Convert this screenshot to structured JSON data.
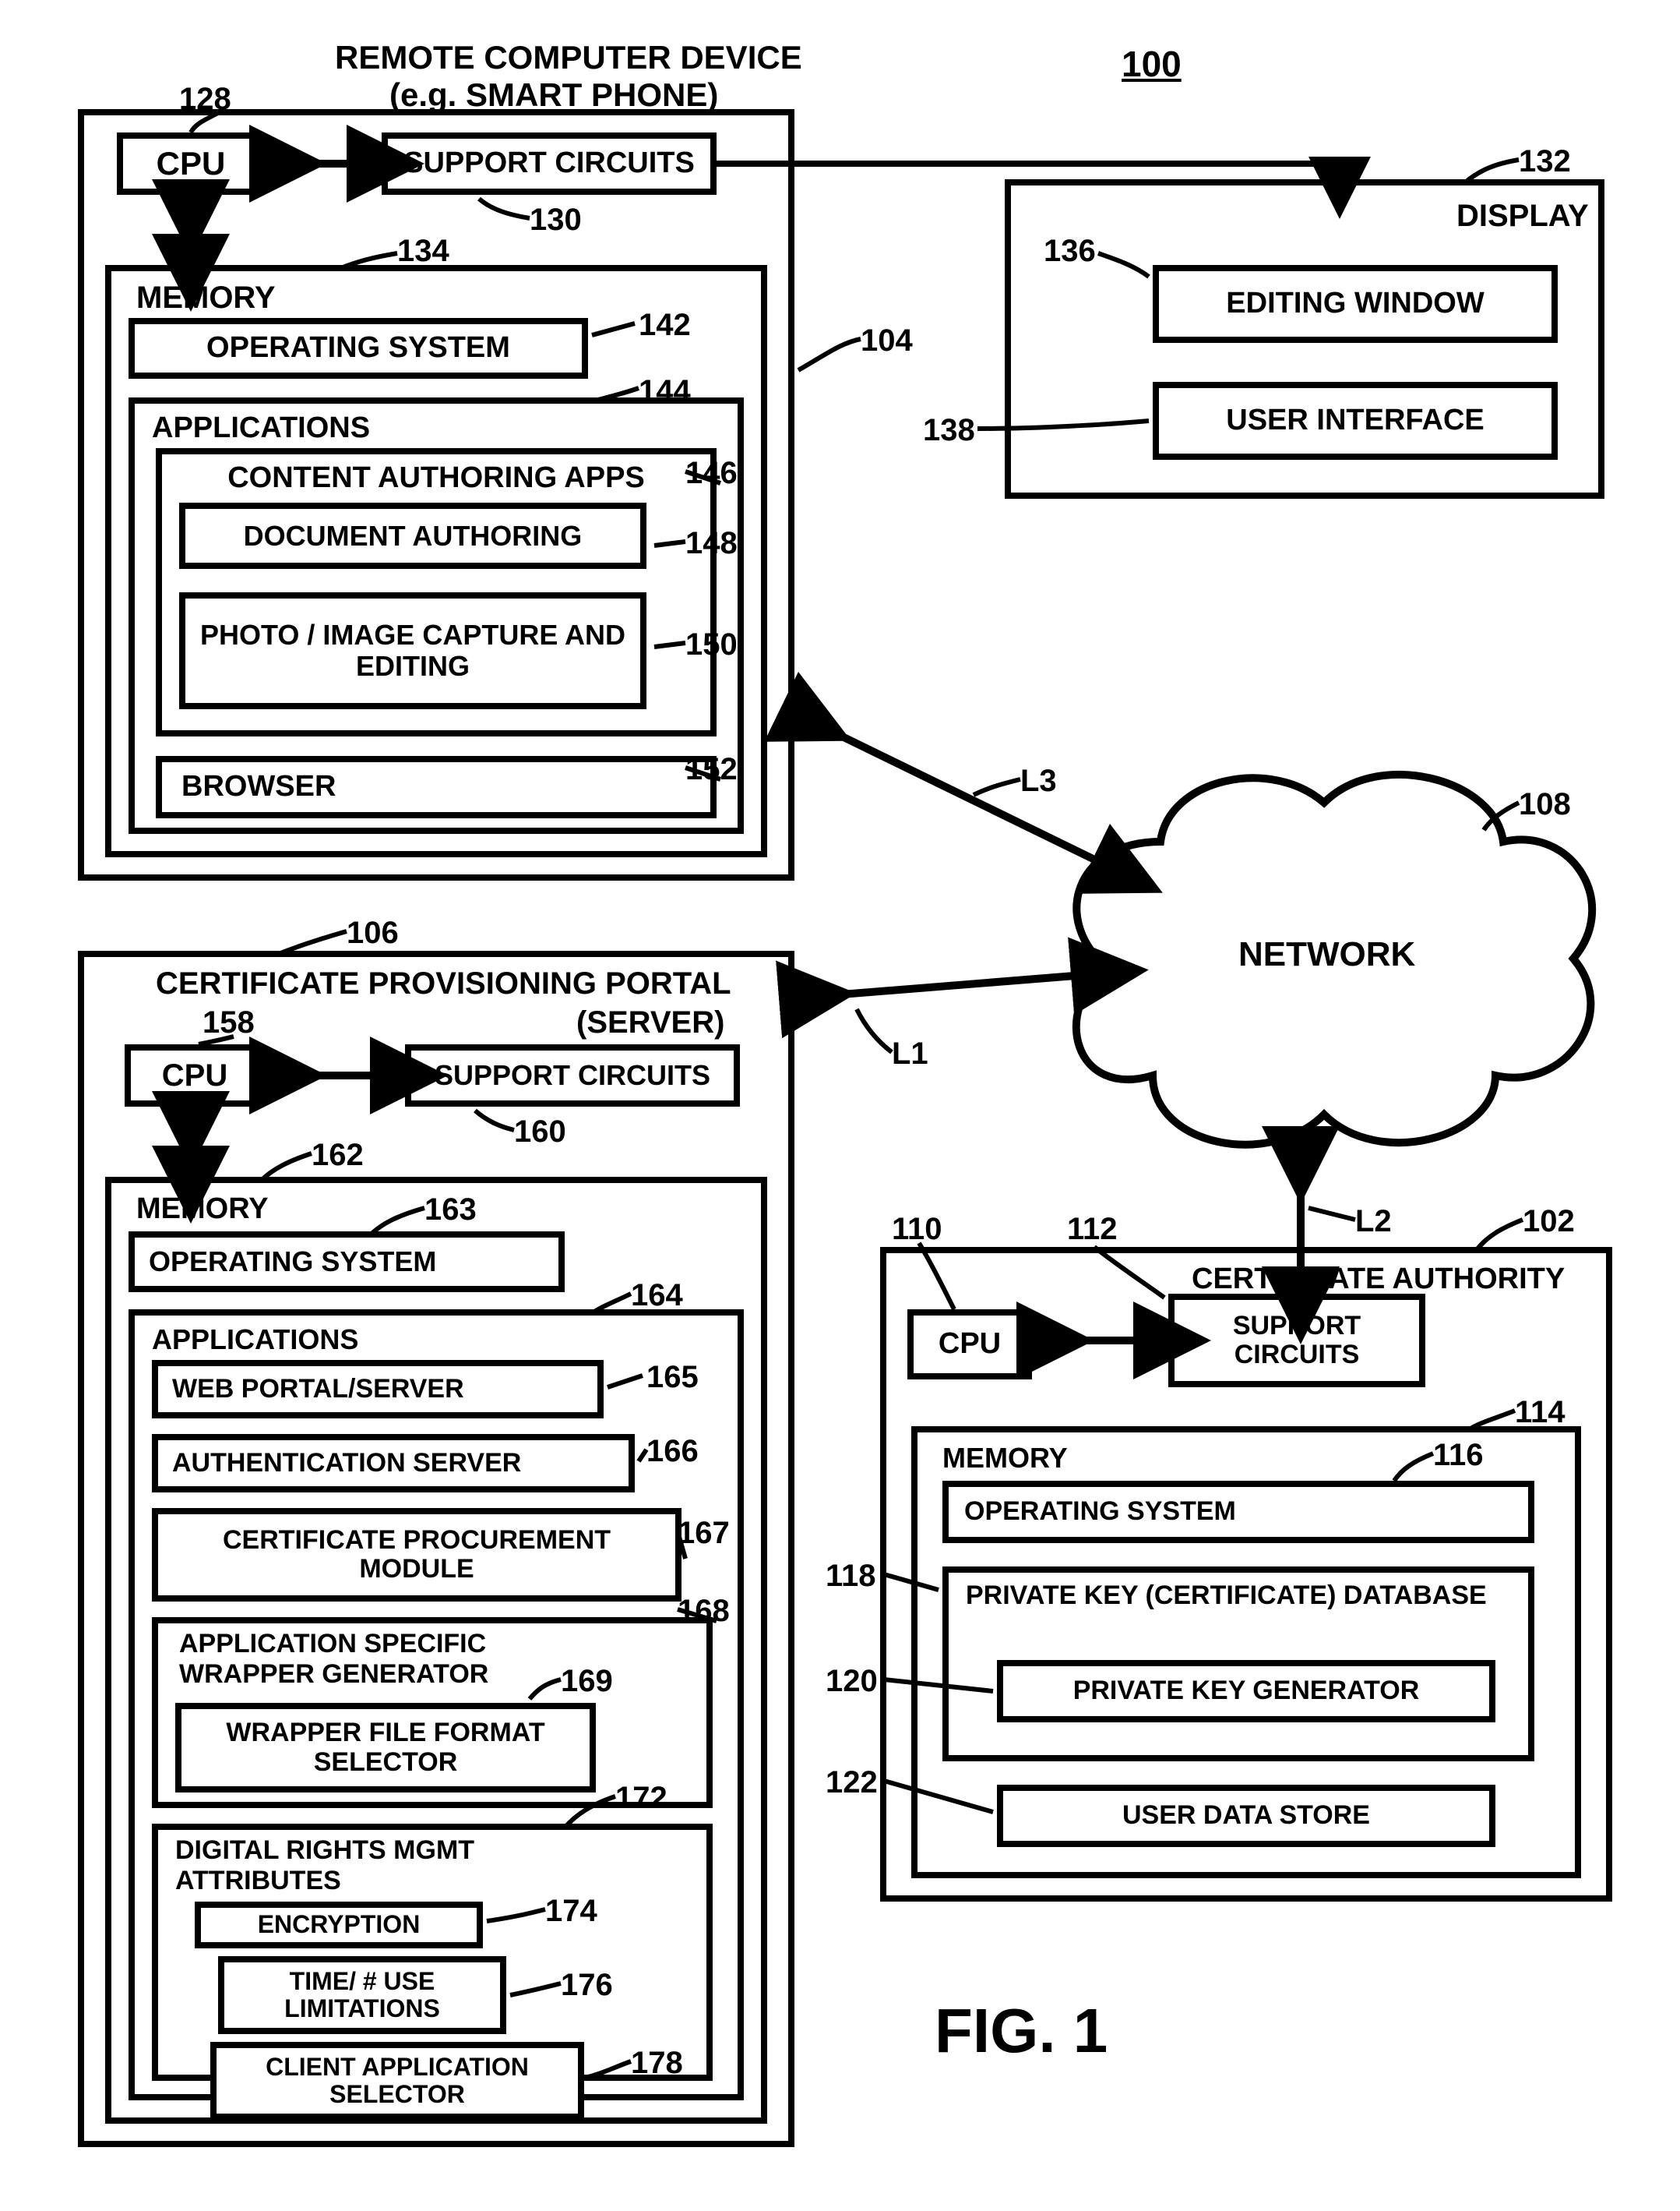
{
  "figure_ref": "100",
  "figure_label": "FIG. 1",
  "remote_device": {
    "title": "REMOTE COMPUTER  DEVICE",
    "subtitle": "(e.g.  SMART PHONE)",
    "ref": "104",
    "cpu": {
      "label": "CPU",
      "ref": "128"
    },
    "support": {
      "label": "SUPPORT CIRCUITS",
      "ref": "130"
    },
    "memory": {
      "label": "MEMORY",
      "ref": "134",
      "os": {
        "label": "OPERATING SYSTEM",
        "ref": "142"
      },
      "apps": {
        "label": "APPLICATIONS",
        "ref": "144",
        "content_auth": {
          "label": "CONTENT AUTHORING APPS",
          "ref": "146",
          "doc": {
            "label": "DOCUMENT AUTHORING",
            "ref": "148"
          },
          "photo": {
            "label": "PHOTO / IMAGE CAPTURE AND EDITING",
            "ref": "150"
          }
        },
        "browser": {
          "label": "BROWSER",
          "ref": "152"
        }
      }
    }
  },
  "display": {
    "label": "DISPLAY",
    "ref": "132",
    "editing": {
      "label": "EDITING WINDOW",
      "ref": "136"
    },
    "ui": {
      "label": "USER INTERFACE",
      "ref": "138"
    }
  },
  "network": {
    "label": "NETWORK",
    "ref": "108"
  },
  "links": {
    "l1": "L1",
    "l2": "L2",
    "l3": "L3"
  },
  "portal": {
    "title": "CERTIFICATE PROVISIONING PORTAL",
    "subtitle": "(SERVER)",
    "ref": "106",
    "cpu": {
      "label": "CPU",
      "ref": "158"
    },
    "support": {
      "label": "SUPPORT CIRCUITS",
      "ref": "160"
    },
    "memory": {
      "label": "MEMORY",
      "ref": "162",
      "os": {
        "label": "OPERATING SYSTEM",
        "ref": "163"
      },
      "apps": {
        "label": "APPLICATIONS",
        "ref": "164",
        "web": {
          "label": "WEB PORTAL/SERVER",
          "ref": "165"
        },
        "auth": {
          "label": "AUTHENTICATION SERVER",
          "ref": "166"
        },
        "cert": {
          "label": "CERTIFICATE PROCUREMENT MODULE",
          "ref": "167"
        },
        "wrapper": {
          "label": "APPLICATION SPECIFIC WRAPPER GENERATOR",
          "ref": "168",
          "format": {
            "label": "WRAPPER FILE FORMAT SELECTOR",
            "ref": "169"
          }
        },
        "drm": {
          "label": "DIGITAL RIGHTS MGMT ATTRIBUTES",
          "ref": "172",
          "enc": {
            "label": "ENCRYPTION",
            "ref": "174"
          },
          "time": {
            "label": "TIME/ # USE LIMITATIONS",
            "ref": "176"
          },
          "client": {
            "label": "CLIENT APPLICATION SELECTOR",
            "ref": "178"
          }
        }
      }
    }
  },
  "ca": {
    "title": "CERTIFICATE AUTHORITY",
    "ref": "102",
    "cpu": {
      "label": "CPU",
      "ref": "110"
    },
    "support": {
      "label": "SUPPORT CIRCUITS",
      "ref": "112"
    },
    "memory": {
      "label": "MEMORY",
      "ref": "114",
      "os": {
        "label": "OPERATING SYSTEM",
        "ref": "116"
      },
      "pk": {
        "label": "PRIVATE KEY (CERTIFICATE) DATABASE",
        "ref": "118",
        "gen": {
          "label": "PRIVATE KEY GENERATOR",
          "ref": "120"
        }
      },
      "user": {
        "label": "USER  DATA STORE",
        "ref": "122"
      }
    }
  }
}
